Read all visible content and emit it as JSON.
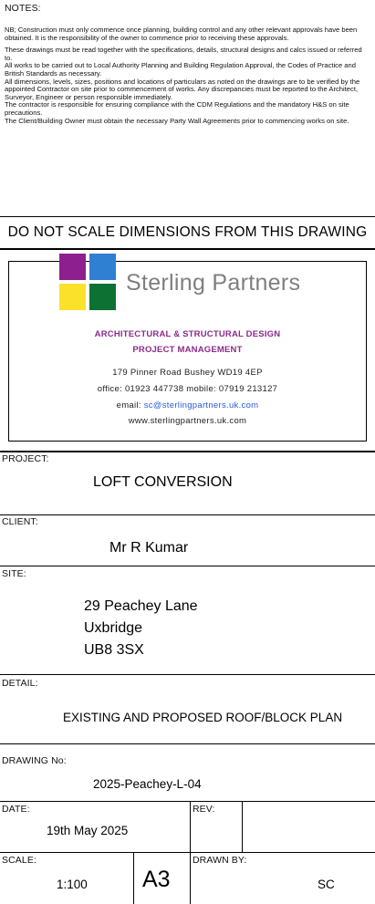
{
  "notes": {
    "title": "NOTES:",
    "paragraphs": [
      "NB; Construction must only commence once planning, building control and any other relevant approvals have been obtained. It is the responsibility of the owner to commence prior to receiving these approvals.",
      "These drawings must be read together with the specifications, details, structural designs and calcs issued or referred to.",
      "All works to be carried out to Local Authority Planning and Building Regulation Approval, the Codes of Practice and British Standards as necessary.",
      "All dimensions, levels, sizes, positions and locations of particulars as noted on the drawings are to be verified by the appointed Contractor on site prior to commencement of works. Any discrepancies must be reported to the Architect, Surveyor, Engineer or person responsible immediately.",
      "The contractor is responsible for ensuring compliance with the CDM Regulations and the mandatory H&S on site precautions.",
      "The Client/Building Owner must obtain the necessary Party Wall Agreements prior to commencing works on site."
    ]
  },
  "warning": "DO NOT SCALE DIMENSIONS FROM THIS DRAWING",
  "company": {
    "name": "Sterling  Partners",
    "tagline1": "ARCHITECTURAL & STRUCTURAL DESIGN",
    "tagline2": "PROJECT MANAGEMENT",
    "address": "179 Pinner Road  Bushey  WD19 4EP",
    "phone": "office: 01923 447738   mobile: 07919 213127",
    "email_label": "email: ",
    "email": "sc@sterlingpartners.uk.com",
    "website": "www.sterlingpartners.uk.com",
    "logo_colors": {
      "purple": "#8e1f8e",
      "blue": "#2f7fd3",
      "yellow": "#fbe12a",
      "green": "#0e7134"
    }
  },
  "project": {
    "label": "PROJECT:",
    "value": "LOFT CONVERSION"
  },
  "client": {
    "label": "CLIENT:",
    "value": "Mr R Kumar"
  },
  "site": {
    "label": "SITE:",
    "lines": [
      "29 Peachey Lane",
      "Uxbridge",
      "UB8 3SX"
    ]
  },
  "detail": {
    "label": "DETAIL:",
    "value": "EXISTING AND PROPOSED ROOF/BLOCK PLAN"
  },
  "drawing_no": {
    "label": "DRAWING No:",
    "value": "2025-Peachey-L-04"
  },
  "date": {
    "label": "DATE:",
    "value": "19th May 2025"
  },
  "rev": {
    "label": "REV:",
    "value": ""
  },
  "scale": {
    "label": "SCALE:",
    "value": "1:100"
  },
  "sheet_size": "A3",
  "drawn_by": {
    "label": "DRAWN BY:",
    "value": "SC"
  }
}
